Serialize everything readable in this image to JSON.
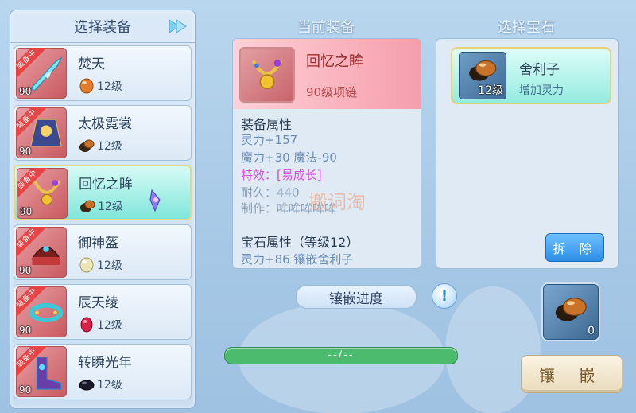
{
  "left": {
    "title": "选择装备",
    "items": [
      {
        "name": "焚天",
        "level": "90",
        "gem_level": "12级",
        "tag": "装备中",
        "gem_color": "#e07c2a"
      },
      {
        "name": "太极霓裳",
        "level": "90",
        "gem_level": "12级",
        "tag": "装备中",
        "gem_color": "#7a4a22"
      },
      {
        "name": "回忆之眸",
        "level": "90",
        "gem_level": "12级",
        "tag": "装备中",
        "gem_color": "#7a4a22",
        "selected": true
      },
      {
        "name": "御神盔",
        "level": "90",
        "gem_level": "12级",
        "tag": "装备中",
        "gem_color": "#e8e2b0"
      },
      {
        "name": "辰天绫",
        "level": "90",
        "gem_level": "12级",
        "tag": "装备中",
        "gem_color": "#d8224a"
      },
      {
        "name": "转瞬光年",
        "level": "90",
        "gem_level": "12级",
        "tag": "装备中",
        "gem_color": "#1a1a2a"
      }
    ]
  },
  "middle": {
    "title": "当前装备",
    "equip_name": "回忆之眸",
    "equip_sub": "90级项链",
    "attr_title": "装备属性",
    "attrs": [
      "灵力+157",
      "魔力+30 魔法-90"
    ],
    "special": "特效：[易成长]",
    "durability": "耐久：440",
    "maker": "制作：哞哞哞哞哞",
    "gem_attr_title": "宝石属性（等级12）",
    "gem_attr": "灵力+86 镶嵌舍利子",
    "watermark": "搬词淘"
  },
  "progress": {
    "label": "镶嵌进度",
    "info_icon": "!",
    "text": "--/--",
    "fraction": 0
  },
  "right": {
    "title": "选择宝石",
    "gem_name": "舍利子",
    "gem_level": "12级",
    "gem_desc": "增加灵力",
    "remove_label": "拆 除",
    "slot_count": "0",
    "embed_label": "镶 嵌"
  }
}
